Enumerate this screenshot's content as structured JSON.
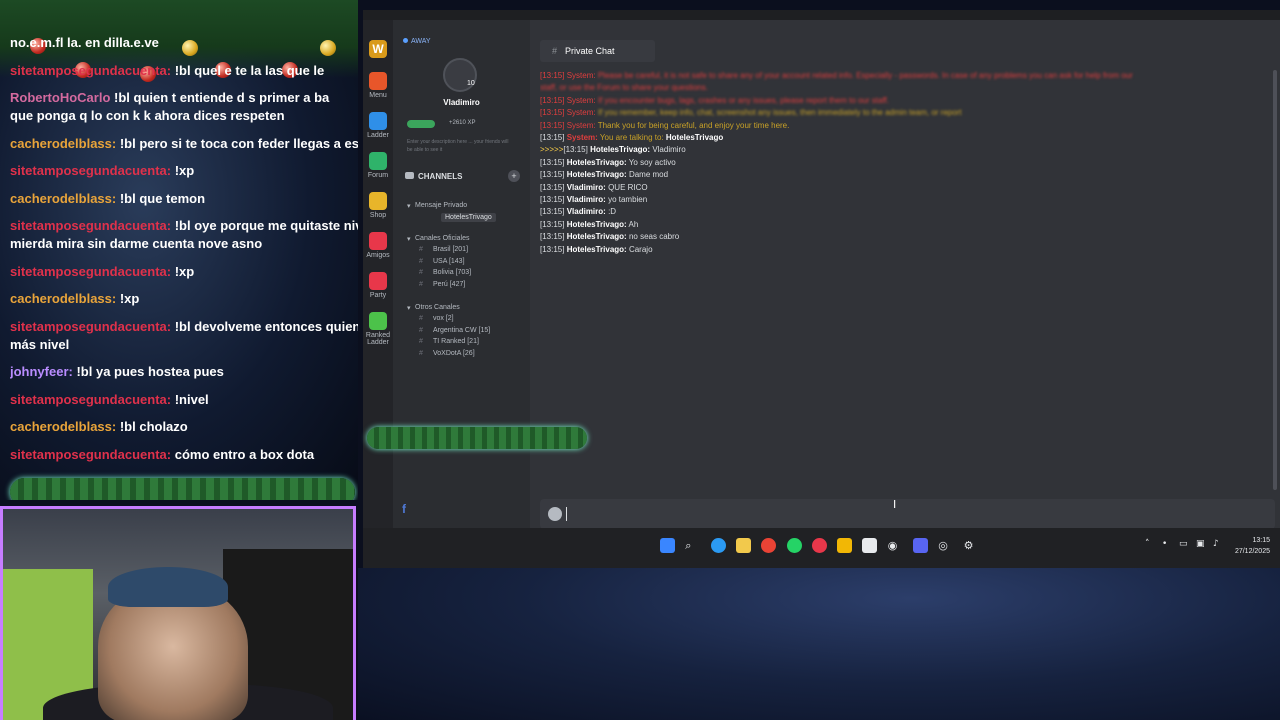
{
  "stream_chat": {
    "messages": [
      {
        "user": "no.e.m.fl la.",
        "text": "en dilla.e.ve",
        "color": "#ffffff"
      },
      {
        "user": "sitetamposegundacuenta:",
        "text": "!bl quel e te la las que le",
        "color": "#e0314b"
      },
      {
        "user": "RobertoHoCarlo",
        "text": "!bl quien t entiende d s primer a ba",
        "color": "#d46a9f",
        "cont": "que ponga q lo con k k ahora dices respeten"
      },
      {
        "user": "cacherodelblass:",
        "text": "!bl pero si te toca con feder llegas a eso",
        "color": "#e9a43a"
      },
      {
        "user": "sitetamposegundacuenta:",
        "text": "!xp",
        "color": "#e0314b"
      },
      {
        "user": "cacherodelblass:",
        "text": "!bl que temon",
        "color": "#e9a43a"
      },
      {
        "user": "sitetamposegundacuenta:",
        "text": "!bl oye porque me quitaste nivel c",
        "color": "#e0314b",
        "cont": "mierda mira sin darme cuenta nove asno"
      },
      {
        "user": "sitetamposegundacuenta:",
        "text": "!xp",
        "color": "#e0314b"
      },
      {
        "user": "cacherodelblass:",
        "text": "!xp",
        "color": "#e9a43a"
      },
      {
        "user": "sitetamposegundacuenta:",
        "text": "!bl devolveme entonces quien me",
        "color": "#e0314b",
        "cont": "más nivel"
      },
      {
        "user": "johnyfeer:",
        "text": "!bl ya pues hostea pues",
        "color": "#b98cff"
      },
      {
        "user": "sitetamposegundacuenta:",
        "text": "!nivel",
        "color": "#e0314b"
      },
      {
        "user": "cacherodelblass:",
        "text": "!bl cholazo",
        "color": "#e9a43a"
      },
      {
        "user": "sitetamposegundacuenta:",
        "text": "cómo entro a box dota",
        "color": "#e0314b"
      }
    ]
  },
  "app": {
    "rail": [
      {
        "label": "Menu",
        "icon": "gear-icon",
        "color": "#e8562a"
      },
      {
        "label": "Ladder",
        "icon": "bar-chart-icon",
        "color": "#2f8fe8"
      },
      {
        "label": "Forum",
        "icon": "forum-icon",
        "color": "#2fb36a"
      },
      {
        "label": "Shop",
        "icon": "shop-icon",
        "color": "#e8b52a"
      },
      {
        "label": "Amigos",
        "icon": "friends-icon",
        "color": "#e8374a"
      },
      {
        "label": "Party",
        "icon": "party-icon",
        "color": "#e8374a"
      },
      {
        "label": "Ranked Ladder",
        "icon": "ranked-icon",
        "color": "#4cc24a"
      }
    ],
    "profile": {
      "status": "AWAY",
      "level": "10",
      "username": "Vladimiro",
      "xp": "+2610 XP",
      "description": "Enter your description here ... your friends will be able to see it"
    },
    "channels": {
      "header": "CHANNELS",
      "private_group": "Mensaje Privado",
      "private_items": [
        "HotelesTrivago"
      ],
      "official_group": "Canales Oficiales",
      "official_items": [
        "Brasil [201]",
        "USA [143]",
        "Bolivia [703]",
        "Perú [427]"
      ],
      "other_group": "Otros Canales",
      "other_items": [
        "vox [2]",
        "Argentina CW [15]",
        "TI Ranked [21]",
        "VoXDotA [26]"
      ]
    },
    "chat": {
      "tab": "Private Chat",
      "lines": [
        {
          "type": "system",
          "ts": "[13:15]",
          "author": "System:",
          "msg": "Please be careful, it is not safe to share any of your account related info. Especially - passwords. In case of any problems you can ask for help from our",
          "style": "blur"
        },
        {
          "type": "system",
          "ts": "",
          "author": "",
          "msg": "staff, or use the Forum to share your questions.",
          "style": "blur"
        },
        {
          "type": "system",
          "ts": "[13:15]",
          "author": "System:",
          "msg": "If you encounter bugs, lags, crashes or any issues, please report them to our staff.",
          "style": "blur"
        },
        {
          "type": "system",
          "ts": "[13:15]",
          "author": "System:",
          "msg": "If you remember, keep info, chat, screenshot any issues, then immediately to the admin team, or report",
          "style": "blur-yellow"
        },
        {
          "type": "system",
          "ts": "[13:15]",
          "author": "System:",
          "msg": "Thank you for being careful, and enjoy your time here.",
          "style": "yellow"
        },
        {
          "type": "talking",
          "ts": "[13:15]",
          "author": "System:",
          "msg": "You are talking to:",
          "target": "HotelesTrivago"
        },
        {
          "type": "user",
          "prompt": ">>>>>",
          "ts": "[13:15]",
          "author": "HotelesTrivago:",
          "msg": "Vladimiro"
        },
        {
          "type": "user",
          "ts": "[13:15]",
          "author": "HotelesTrivago:",
          "msg": "Yo soy activo"
        },
        {
          "type": "user",
          "ts": "[13:15]",
          "author": "HotelesTrivago:",
          "msg": "Dame mod"
        },
        {
          "type": "user",
          "ts": "[13:15]",
          "author": "Vladimiro:",
          "msg": "QUE RICO"
        },
        {
          "type": "user",
          "ts": "[13:15]",
          "author": "Vladimiro:",
          "msg": "yo tambien"
        },
        {
          "type": "user",
          "ts": "[13:15]",
          "author": "Vladimiro:",
          "msg": ":D"
        },
        {
          "type": "user",
          "ts": "[13:15]",
          "author": "HotelesTrivago:",
          "msg": "Ah"
        },
        {
          "type": "user",
          "ts": "[13:15]",
          "author": "HotelesTrivago:",
          "msg": "no seas cabro"
        },
        {
          "type": "user",
          "ts": "[13:15]",
          "author": "HotelesTrivago:",
          "msg": "Carajo"
        }
      ]
    }
  },
  "taskbar": {
    "time": "13:15",
    "date": "27/12/2025",
    "apps": [
      "start-icon",
      "search-icon",
      "edge-icon",
      "notes-icon",
      "chrome-icon",
      "whatsapp-icon",
      "opera-icon",
      "files-icon",
      "store-icon",
      "game-icon",
      "discord-icon",
      "steam-icon",
      "settings-icon"
    ]
  }
}
